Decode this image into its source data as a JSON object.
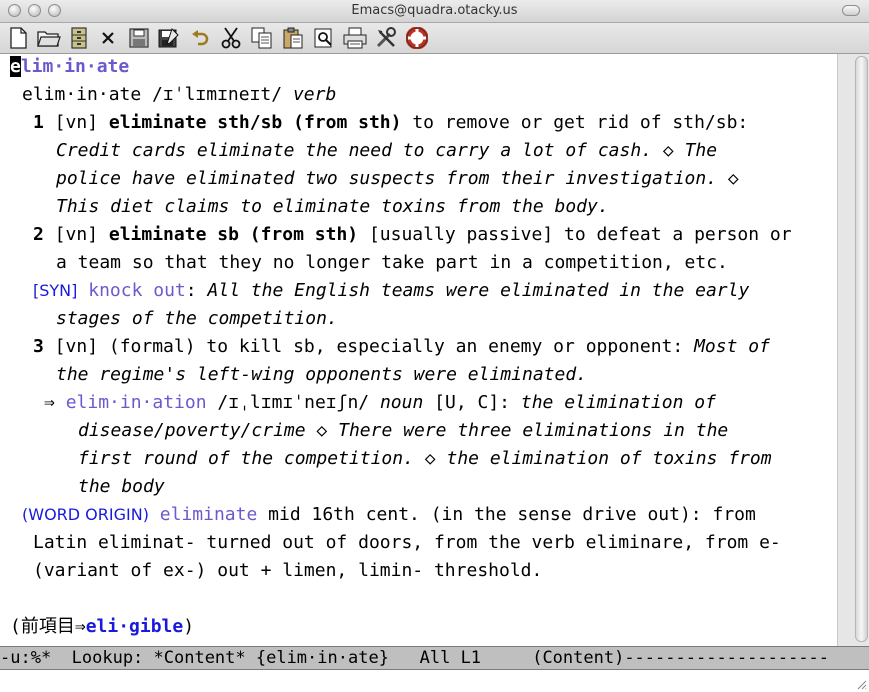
{
  "window": {
    "title": "Emacs@quadra.otacky.us"
  },
  "toolbar": {
    "buttons": [
      {
        "name": "new-file-button",
        "icon": "new-file-icon"
      },
      {
        "name": "open-folder-button",
        "icon": "folder-icon"
      },
      {
        "name": "dired-button",
        "icon": "file-cabinet-icon"
      },
      {
        "name": "close-buffer-button",
        "icon": "close-icon"
      },
      {
        "name": "save-button",
        "icon": "floppy-icon"
      },
      {
        "name": "save-as-button",
        "icon": "floppy-pen-icon"
      },
      {
        "name": "undo-button",
        "icon": "undo-icon"
      },
      {
        "name": "cut-button",
        "icon": "scissors-icon"
      },
      {
        "name": "copy-button",
        "icon": "copy-icon"
      },
      {
        "name": "paste-button",
        "icon": "paste-icon"
      },
      {
        "name": "search-button",
        "icon": "search-icon"
      },
      {
        "name": "print-button",
        "icon": "printer-icon"
      },
      {
        "name": "preferences-button",
        "icon": "tools-icon"
      },
      {
        "name": "help-button",
        "icon": "lifebuoy-icon"
      }
    ]
  },
  "entry": {
    "headword": "elim·in·ate",
    "headword_first_char": "e",
    "headword_rest": "lim·in·ate",
    "pron_line": {
      "word": "elim·in·ate",
      "pron": " /ɪˈlɪmɪneɪt/ ",
      "pos": "verb"
    },
    "sense1": {
      "num": "1",
      "code": " [vn] ",
      "phrase": "eliminate sth/sb (from sth)",
      "def": " to remove or get rid of sth/sb:",
      "ex1": "Credit cards eliminate the need to carry a lot of cash.",
      "ex2_a": "The",
      "ex2_b": "police have eliminated two suspects from their investigation.",
      "ex3": "This diet claims to eliminate toxins from the body."
    },
    "sense2": {
      "num": "2",
      "code": " [vn] ",
      "phrase": "eliminate sb (from sth)",
      "def_a": " [usually passive] to defeat a person or",
      "def_b": "a team so that they no longer take part in a competition, etc.",
      "syn_tag": "[SYN]",
      "syn_word": "knock out",
      "ex1_a": "All the English teams were eliminated in the early",
      "ex1_b": "stages of the competition."
    },
    "sense3": {
      "num": "3",
      "def": " [vn] (formal) to kill sb, especially an enemy or opponent: ",
      "ex1_a": "Most of",
      "ex1_b": "the regime's left-wing opponents were eliminated."
    },
    "derived": {
      "arrow": "⇒",
      "word": "elim·in·ation",
      "pron": " /ɪˌlɪmɪˈneɪʃn/ ",
      "pos": "noun",
      "code": " [U, C]: ",
      "ex1": "the elimination of",
      "ex1_b": "disease/poverty/crime",
      "ex2_a": "There were three eliminations in the",
      "ex2_b": "first round of the competition.",
      "ex3_a": "the elimination of toxins from",
      "ex3_b": "the body"
    },
    "origin": {
      "tag": "(WORD ORIGIN)",
      "word": "eliminate",
      "line1": " mid 16th cent. (in the sense drive out): from",
      "line2": "Latin eliminat- turned out of doors, from the verb eliminare, from e-",
      "line3": "(variant of ex-) out + limen, limin- threshold."
    },
    "prev": {
      "open": "(前項目⇒",
      "link": "eli·gible",
      "close": ")"
    },
    "diamond": "◇"
  },
  "modeline": {
    "text": "-u:%*  Lookup: *Content* {elim·in·ate}   All L1     (Content)--------------------"
  }
}
